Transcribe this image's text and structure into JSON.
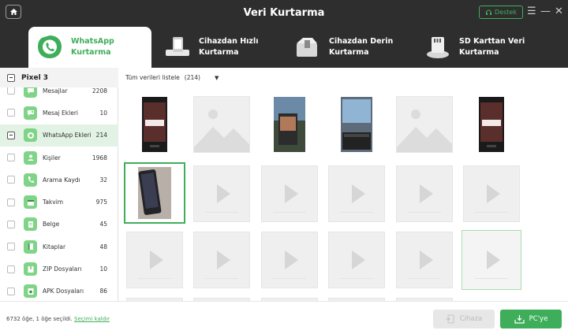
{
  "header": {
    "title": "Veri Kurtarma",
    "support_label": "Destek",
    "menu_glyph": "☰",
    "minimize_glyph": "—",
    "close_glyph": "✕"
  },
  "tabs": [
    {
      "line1": "WhatsApp",
      "line2": "Kurtarma",
      "icon": "whatsapp-icon",
      "active": true
    },
    {
      "line1": "Cihazdan Hızlı",
      "line2": "Kurtarma",
      "icon": "phone-scan-icon",
      "active": false
    },
    {
      "line1": "Cihazdan Derin",
      "line2": "Kurtarma",
      "icon": "deep-scan-icon",
      "active": false
    },
    {
      "line1": "SD Karttan Veri",
      "line2": "Kurtarma",
      "icon": "sd-card-icon",
      "active": false
    }
  ],
  "sidebar": {
    "device_name": "Pixel 3",
    "categories": [
      {
        "label": "Mesajlar",
        "count": "2208",
        "icon": "message-icon"
      },
      {
        "label": "Mesaj Ekleri",
        "count": "10",
        "icon": "attachment-icon"
      },
      {
        "label": "WhatsApp Ekleri",
        "count": "214",
        "icon": "whatsapp-icon"
      },
      {
        "label": "Kişiler",
        "count": "1968",
        "icon": "contact-icon"
      },
      {
        "label": "Arama Kaydı",
        "count": "32",
        "icon": "phone-icon"
      },
      {
        "label": "Takvim",
        "count": "975",
        "icon": "calendar-icon"
      },
      {
        "label": "Belge",
        "count": "45",
        "icon": "document-icon"
      },
      {
        "label": "Kitaplar",
        "count": "48",
        "icon": "book-icon"
      },
      {
        "label": "ZIP Dosyaları",
        "count": "10",
        "icon": "zip-icon"
      },
      {
        "label": "APK Dosyaları",
        "count": "86",
        "icon": "apk-icon"
      }
    ]
  },
  "main": {
    "filter_label": "Tüm verileri listele",
    "filter_count": "(214)"
  },
  "footer": {
    "status_text": "6732 öğe, 1 öğe seçildi.",
    "clear_selection": "Seçimi kaldır",
    "to_device_label": "Cihaza",
    "to_pc_label": "PC'ye"
  },
  "colors": {
    "accent": "#3fae5a",
    "header_bg": "#2e2e2e",
    "selected_row_bg": "#e2f2e4"
  }
}
